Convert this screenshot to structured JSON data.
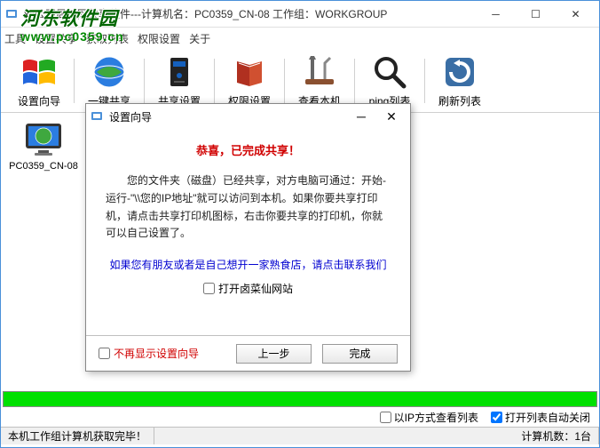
{
  "window": {
    "title": "xx公司局域网共享软件---计算机名：PC0359_CN-08  工作组：WORKGROUP"
  },
  "menu": {
    "items": [
      "工具",
      "设置共享",
      "获取列表",
      "权限设置",
      "关于"
    ]
  },
  "watermark": {
    "line1": "河东软件园",
    "line2": "www.pc0359.cn"
  },
  "toolbar": {
    "items": [
      {
        "label": "设置向导"
      },
      {
        "label": "一键共享"
      },
      {
        "label": "共享设置"
      },
      {
        "label": "权限设置"
      },
      {
        "label": "查看本机"
      },
      {
        "label": "ping列表"
      },
      {
        "label": "刷新列表"
      }
    ]
  },
  "desktop": {
    "item1": {
      "label": "PC0359_CN-08"
    }
  },
  "wizard": {
    "title": "设置向导",
    "heading": "恭喜，已完成共享！",
    "body": "您的文件夹（磁盘）已经共享，对方电脑可通过：开始-运行-\"\\\\您的IP地址\"就可以访问到本机。如果你要共享打印机，请点击共享打印机图标，右击你要共享的打印机，你就可以自己设置了。",
    "link": "如果您有朋友或者是自己想开一家熟食店，请点击联系我们",
    "open_site_label": "打开卤菜仙网站",
    "no_hint_label": "不再显示设置向导",
    "prev": "上一步",
    "finish": "完成"
  },
  "options": {
    "ip_mode": "以IP方式查看列表",
    "auto_close": "打开列表自动关闭"
  },
  "status": {
    "left": "本机工作组计算机获取完毕！",
    "right": "计算机数：1台"
  }
}
